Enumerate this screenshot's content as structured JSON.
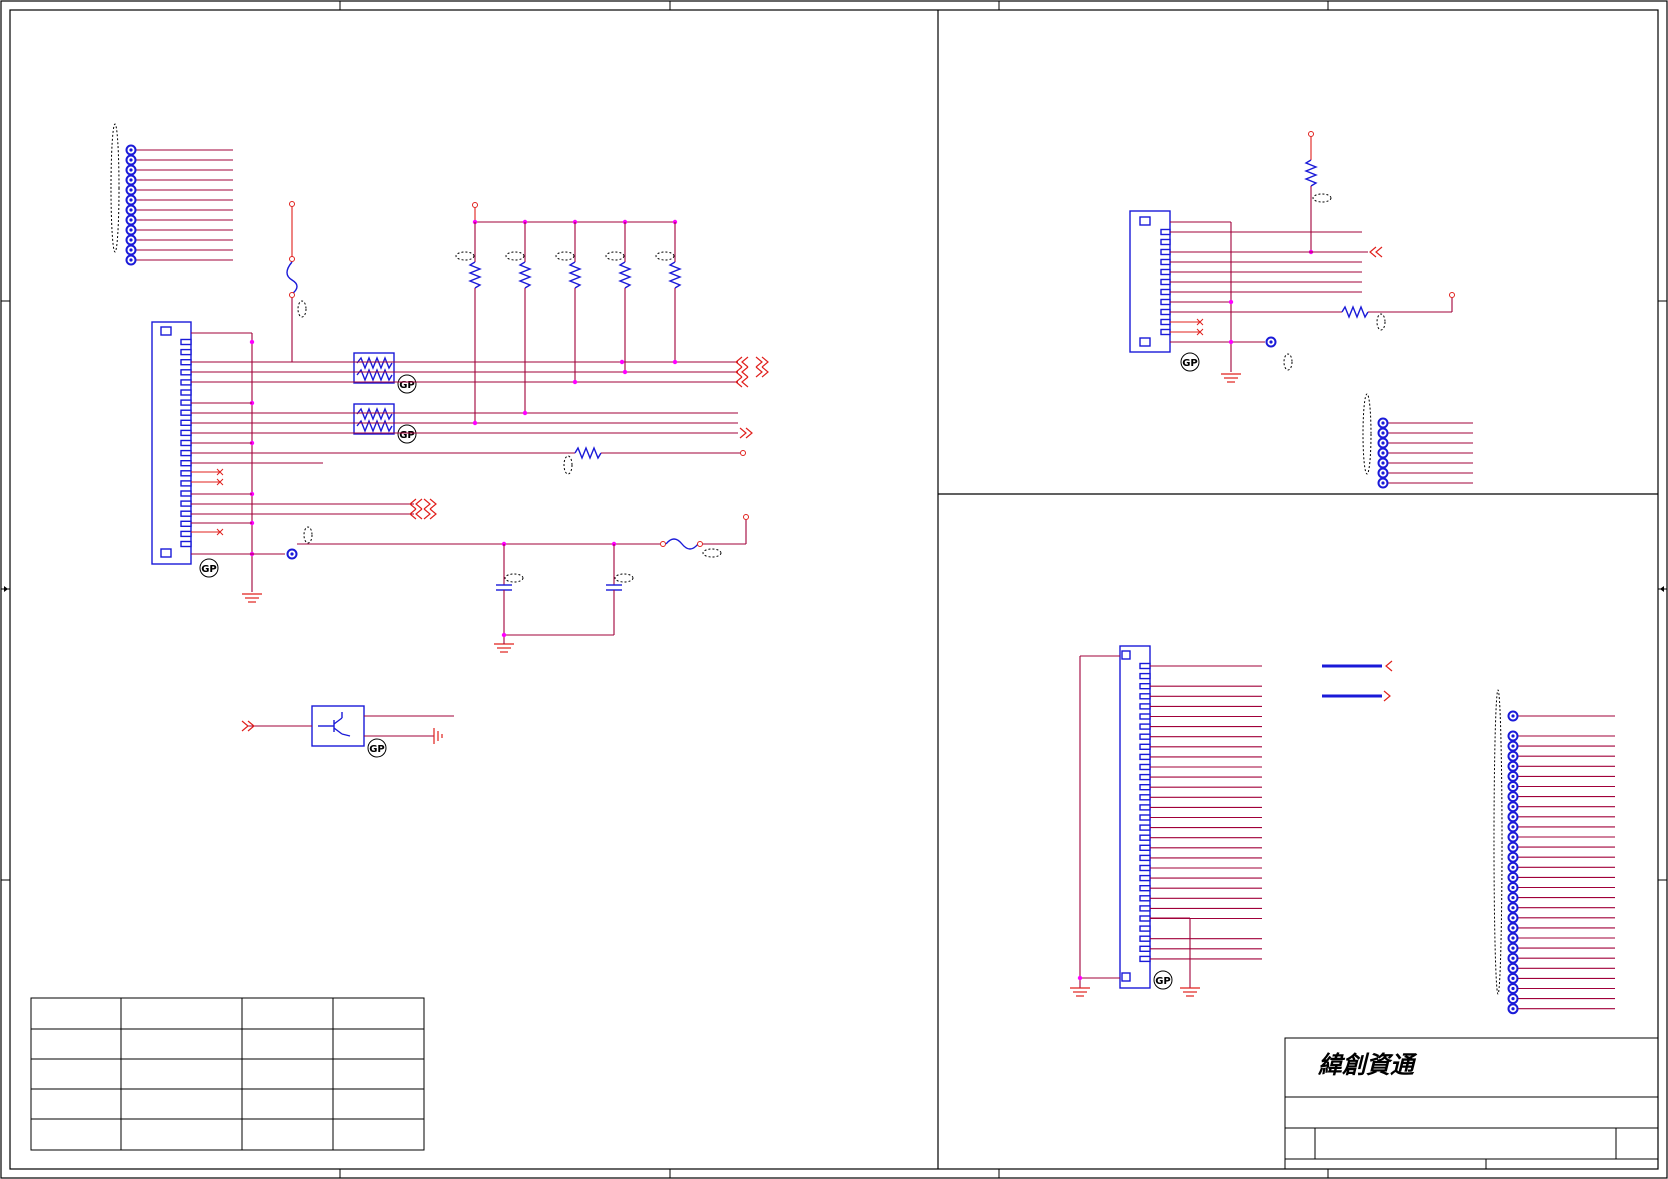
{
  "title_block": {
    "company": "緯創資通"
  },
  "part_markers": {
    "gp": "GP"
  },
  "colors": {
    "wire": "#a0003a",
    "pin": "#e0201c",
    "component": "#1a1ad8",
    "junction": "#ff00ff",
    "frame": "#000000"
  }
}
